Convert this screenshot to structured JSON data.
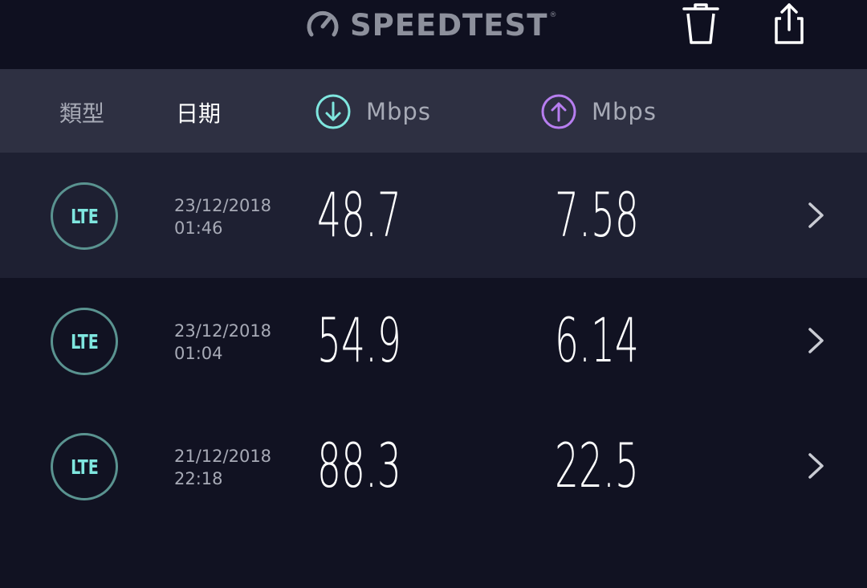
{
  "app": {
    "logo_text": "SPEEDTEST",
    "logo_reg": "®"
  },
  "toolbar": {
    "trash_icon": "trash-icon",
    "share_icon": "share-icon"
  },
  "header": {
    "type_label": "類型",
    "date_label": "日期",
    "download_unit": "Mbps",
    "upload_unit": "Mbps"
  },
  "colors": {
    "download_accent": "#7fe6df",
    "upload_accent": "#b77ef0",
    "lte_badge": "#7fe6df"
  },
  "results": [
    {
      "type": "LTE",
      "date": "23/12/2018",
      "time": "01:46",
      "download": "48.7",
      "upload": "7.58"
    },
    {
      "type": "LTE",
      "date": "23/12/2018",
      "time": "01:04",
      "download": "54.9",
      "upload": "6.14"
    },
    {
      "type": "LTE",
      "date": "21/12/2018",
      "time": "22:18",
      "download": "88.3",
      "upload": "22.5"
    }
  ]
}
